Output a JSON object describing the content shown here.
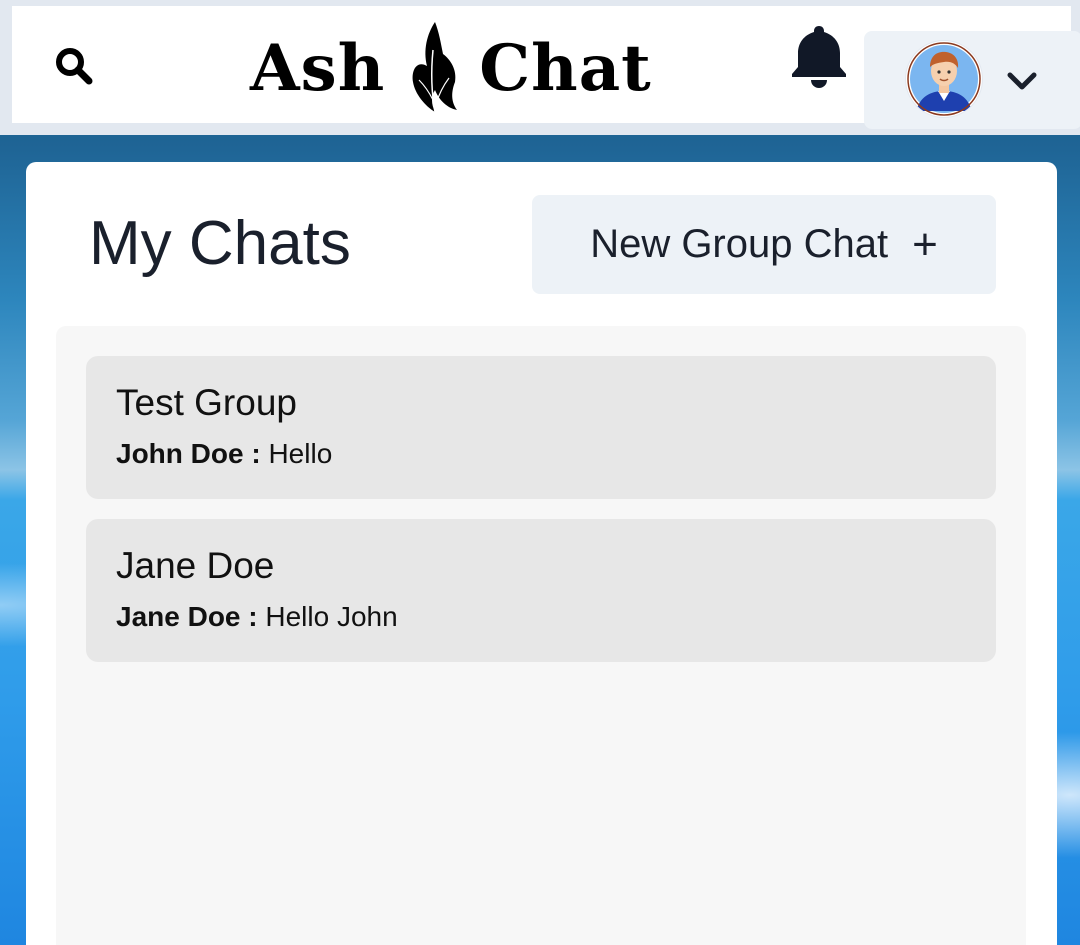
{
  "header": {
    "brand_left": "Ash",
    "brand_right": "Chat",
    "search_icon": "search-icon",
    "bell_icon": "bell-icon",
    "chevron_icon": "chevron-down-icon"
  },
  "chats_panel": {
    "title": "My Chats",
    "new_group_label": "New Group Chat",
    "new_group_icon": "+",
    "chats": [
      {
        "name": "Test Group",
        "sender": "John Doe",
        "separator": " : ",
        "message": "Hello"
      },
      {
        "name": "Jane Doe",
        "sender": "Jane Doe",
        "separator": " : ",
        "message": "Hello John"
      }
    ]
  },
  "colors": {
    "text_dark": "#1a202c",
    "button_bg": "#edf2f7",
    "chat_item_bg": "#e7e7e7",
    "chat_list_bg": "#f7f7f7"
  }
}
